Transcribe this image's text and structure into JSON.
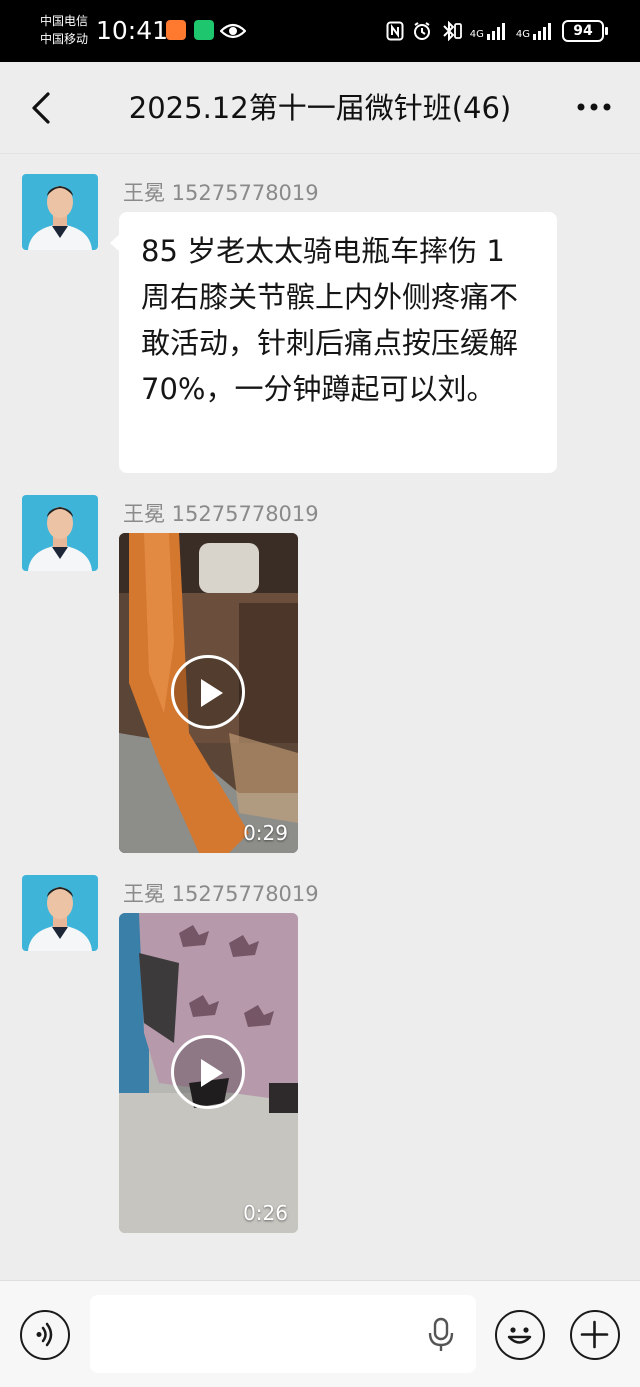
{
  "status_bar": {
    "carrier_1": "中国电信",
    "carrier_2": "中国移动",
    "time": "10:41",
    "network_1": "4G",
    "network_2": "4G",
    "battery": "94",
    "icons": [
      "carrier-app-icon-orange",
      "hourglass-app-icon-green",
      "eye-icon",
      "nfc-icon",
      "alarm-icon",
      "bluetooth-icon",
      "vibrate-icon",
      "signal-icon",
      "signal-icon",
      "battery-icon"
    ]
  },
  "header": {
    "title": "2025.12第十一届微针班(46)",
    "back_icon": "back-arrow-icon",
    "more_icon": "more-dots-icon"
  },
  "messages": [
    {
      "sender": "王冕   15275778019",
      "type": "text",
      "text": "85 岁老太太骑电瓶车摔伤 1 周右膝关节髌上内外侧疼痛不敢活动，针刺后痛点按压缓解 70%，一分钟蹲起可以刘。"
    },
    {
      "sender": "王冕   15275778019",
      "type": "video",
      "duration": "0:29"
    },
    {
      "sender": "王冕   15275778019",
      "type": "video",
      "duration": "0:26"
    }
  ],
  "input_bar": {
    "voice_icon": "voice-mode-icon",
    "mic_icon": "microphone-icon",
    "emoji_icon": "emoji-icon",
    "plus_icon": "plus-icon",
    "text_value": ""
  }
}
